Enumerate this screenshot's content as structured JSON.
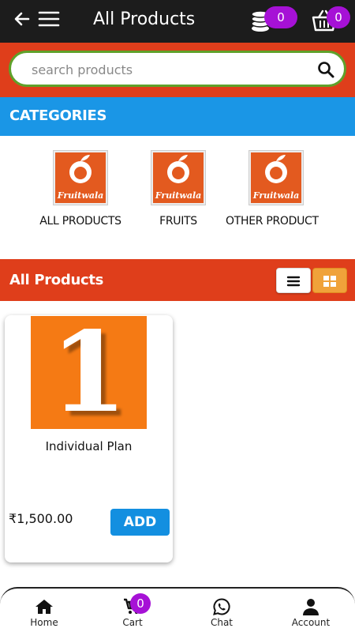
{
  "header": {
    "title": "All Products",
    "wallet_count": "0",
    "cart_count": "0"
  },
  "search": {
    "placeholder": "search products"
  },
  "categories": {
    "title": "CATEGORIES",
    "logo_text": "Fruitwala",
    "items": [
      {
        "label": "ALL PRODUCTS"
      },
      {
        "label": "FRUITS"
      },
      {
        "label": "OTHER PRODUCT"
      }
    ]
  },
  "products": {
    "title": "All Products",
    "items": [
      {
        "image_text": "1",
        "name": "Individual Plan",
        "price": "₹1,500.00",
        "add_label": "ADD"
      }
    ]
  },
  "bottom_nav": {
    "items": [
      {
        "label": "Home"
      },
      {
        "label": "Cart"
      },
      {
        "label": "Chat"
      },
      {
        "label": "Account"
      }
    ],
    "cart_count": "0"
  },
  "colors": {
    "topbar": "#1c1c1c",
    "brand_orange": "#df3e1b",
    "category_blue": "#1a96e6",
    "badge_purple": "#a611d6",
    "add_button": "#138fe0",
    "grid_button": "#f0a23a"
  },
  "icons": [
    "back-arrow-icon",
    "hamburger-menu-icon",
    "coins-icon",
    "basket-icon",
    "search-icon",
    "list-view-icon",
    "grid-view-icon",
    "home-icon",
    "cart-icon",
    "whatsapp-icon",
    "user-icon"
  ]
}
